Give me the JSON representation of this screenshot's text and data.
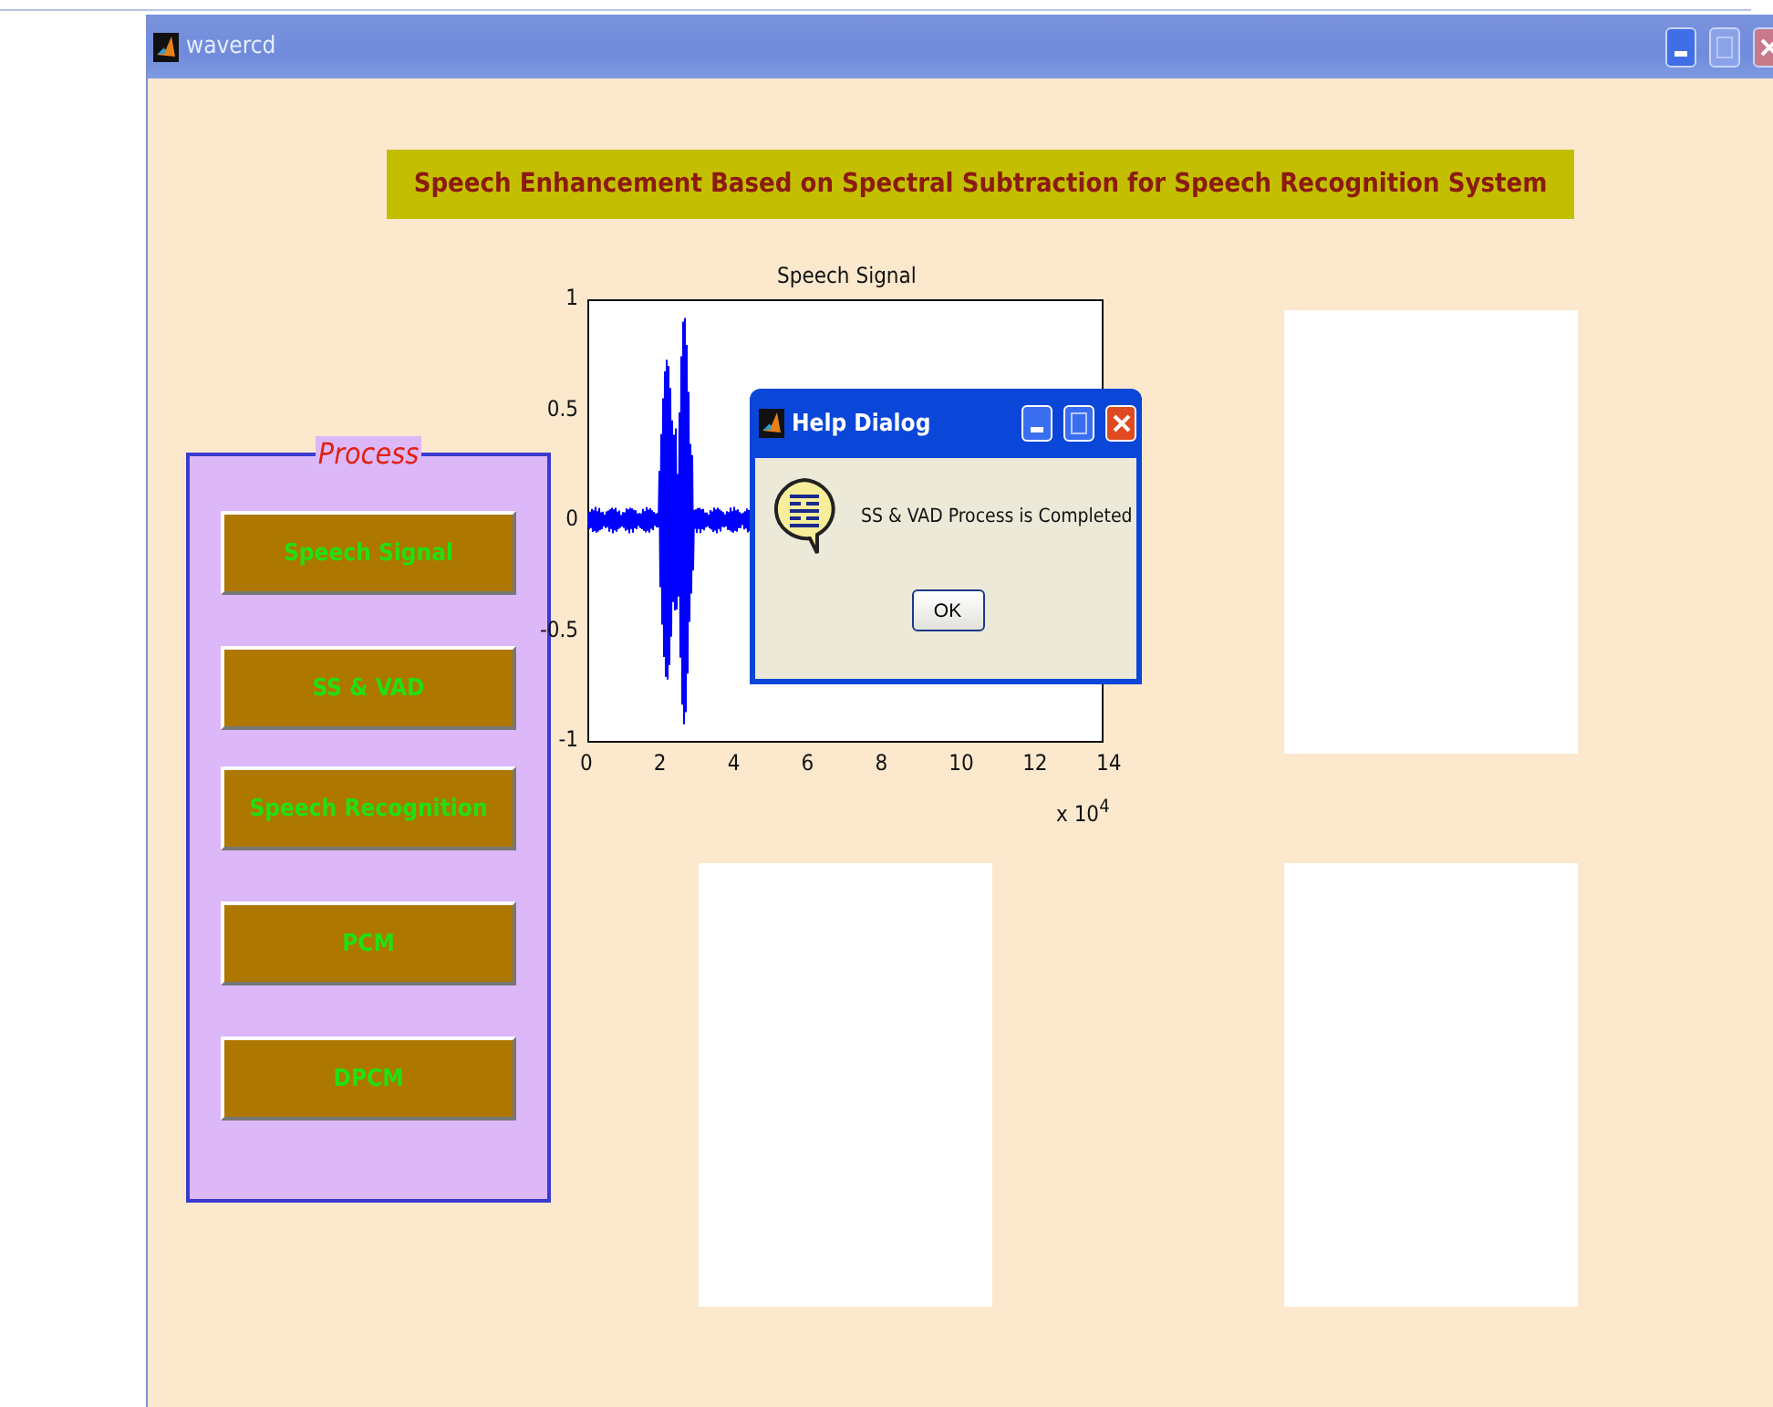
{
  "window": {
    "title": "wavercd"
  },
  "banner": "Speech Enhancement Based on Spectral Subtraction for Speech Recognition System",
  "process_panel": {
    "title": "Process",
    "buttons": [
      "Speech Signal",
      "SS & VAD",
      "Speech Recognition",
      "PCM",
      "DPCM"
    ]
  },
  "axes": {
    "title": "Speech Signal",
    "yticks": [
      "1",
      "0.5",
      "0",
      "-0.5",
      "-1"
    ],
    "xticks": [
      "0",
      "2",
      "4",
      "6",
      "8",
      "10",
      "12",
      "14"
    ],
    "x_multiplier": "x 10$^{4}$"
  },
  "dialog": {
    "title": "Help Dialog",
    "message": "SS & VAD Process is Completed",
    "button": "OK"
  }
}
